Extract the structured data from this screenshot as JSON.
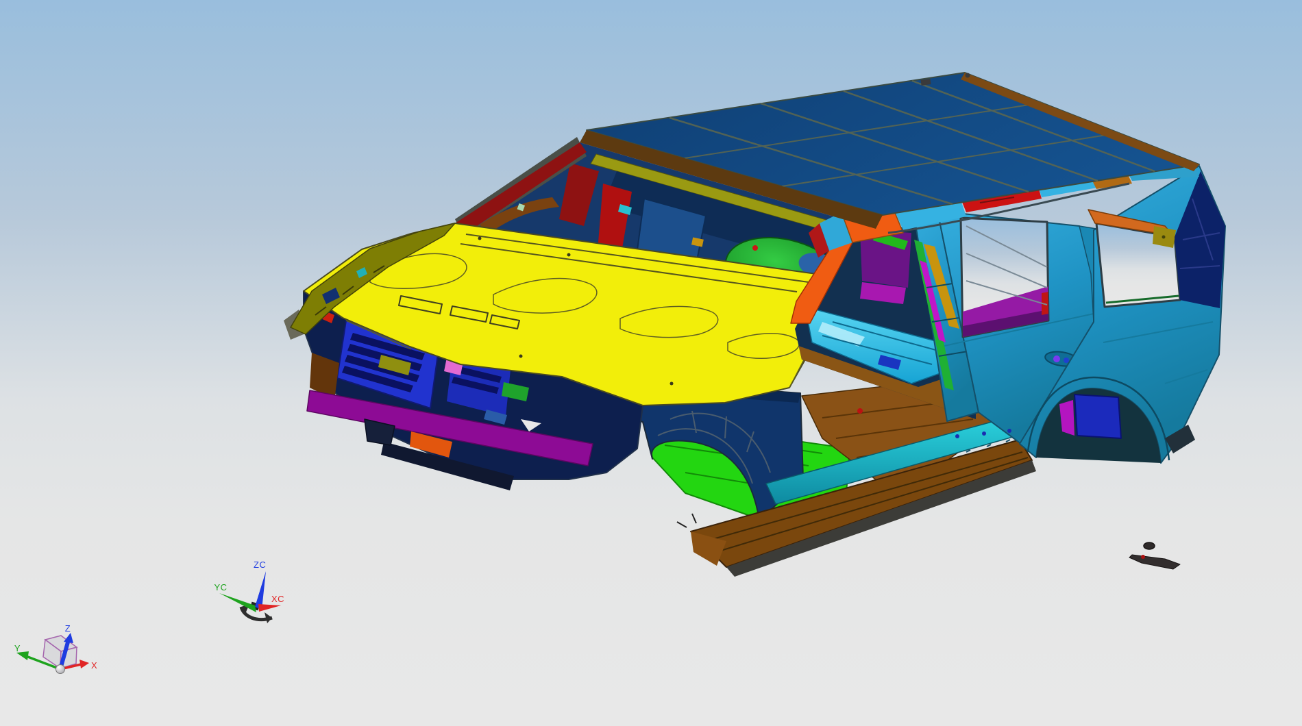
{
  "app": {
    "name": "cad-3d-viewport",
    "model_name": "suv-body-in-white"
  },
  "background": {
    "top": "#99bedd",
    "upper_mid": "#b7c9da",
    "lower_mid": "#dde1e4",
    "bottom": "#e8e8e8"
  },
  "wcs_triad": {
    "z_label": "ZC",
    "y_label": "YC",
    "x_label": "XC",
    "z_color": "#1f3ce0",
    "y_color": "#1ea31e",
    "x_color": "#e02525",
    "handle_color": "#2e2e2e"
  },
  "datum_csys": {
    "z_label": "Z",
    "y_label": "Y",
    "x_label": "X",
    "z_color": "#1f3ce0",
    "y_color": "#1ea31e",
    "x_color": "#e02525",
    "cube_edge_color": "#a565ad"
  },
  "palette": {
    "roof": "#11497e",
    "roof_trim": "#7c4a14",
    "header_brown": "#5d3a10",
    "hood": "#f2ee0a",
    "fender_strip": "#7e7e04",
    "body_teal": "#1f93c4",
    "body_teal_light": "#35b2e2",
    "rocker_brown": "#7a470d",
    "floor_brown": "#8a5216",
    "sill_cyan": "#2ad0dc",
    "floor_cyan": "#3cc2ee",
    "apron_navy": "#10356b",
    "front_navy": "#0d1f4e",
    "radiator_blue": "#2133cf",
    "crossmember_magenta": "#8d0b95",
    "cowl_magenta": "#ad17b5",
    "quarter_purple": "#951aa5",
    "green_floor": "#23d611",
    "green_wheelhouse": "#1fae2e",
    "pillar_red": "#cc1212",
    "pillar_orange": "#f05c12",
    "tank_navy": "#1b2abc",
    "dpillar_navy": "#0c2268",
    "olive_header": "#9a9a12",
    "goldenrod": "#c8940e",
    "ws_interior": "#16396b",
    "dark_red_pillar": "#8e1212"
  }
}
